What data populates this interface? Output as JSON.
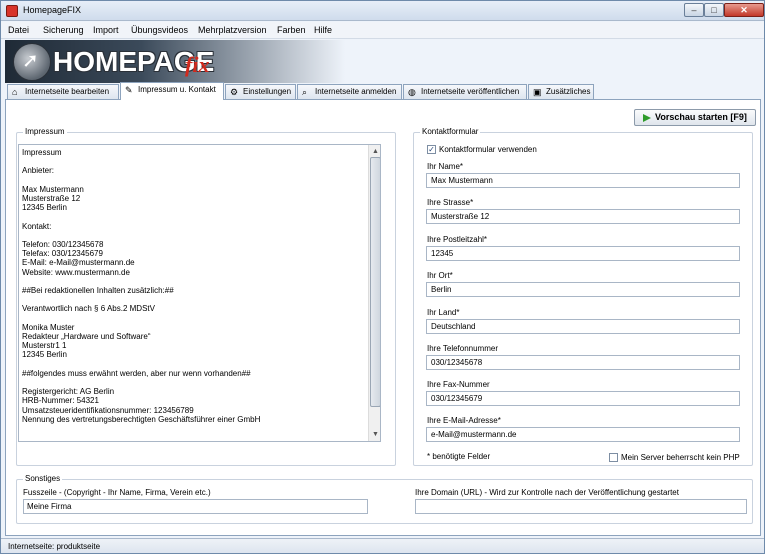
{
  "window": {
    "title": "HomepageFIX"
  },
  "menu": [
    "Datei",
    "Sicherung",
    "Import",
    "Übungsvideos",
    "Mehrplatzversion",
    "Farben",
    "Hilfe"
  ],
  "banner": {
    "logo_text": "HOMEPAGE",
    "logo_suffix": "fix"
  },
  "tabs": [
    {
      "label": "Internetseite bearbeiten",
      "icon": "house-icon"
    },
    {
      "label": "Impressum u. Kontakt",
      "icon": "notepad-icon"
    },
    {
      "label": "Einstellungen",
      "icon": "settings-icon"
    },
    {
      "label": "Internetseite anmelden",
      "icon": "search-icon"
    },
    {
      "label": "Internetseite veröffentlichen",
      "icon": "globe-icon"
    },
    {
      "label": "Zusätzliches",
      "icon": "image-icon"
    }
  ],
  "toolbar": {
    "preview_label": "Vorschau starten [F9]"
  },
  "impressum": {
    "group_label": "Impressum",
    "text_lines": [
      "Impressum",
      "",
      "Anbieter:",
      "",
      "Max Mustermann",
      "Musterstraße 12",
      "12345 Berlin",
      "",
      "Kontakt:",
      "",
      "Telefon: 030/12345678",
      "Telefax: 030/12345679",
      "E-Mail: e-Mail@mustermann.de",
      "Website: www.mustermann.de",
      "",
      "##Bei redaktionellen Inhalten zusätzlich:##",
      "",
      "Verantwortlich nach § 6 Abs.2 MDStV",
      "",
      "Monika Muster",
      "Redakteur „Hardware und Software“",
      "Musterstr1 1",
      "12345 Berlin",
      "",
      "##folgendes muss erwähnt werden, aber nur wenn vorhanden##",
      "",
      "Registergericht: AG Berlin",
      "HRB-Nummer: 54321",
      "Umsatzsteueridentifikationsnummer: 123456789",
      "Nennung des vertretungsberechtigten Geschäftsführer einer GmbH"
    ]
  },
  "kontakt": {
    "group_label": "Kontaktformular",
    "use_form_label": "Kontaktformular verwenden",
    "use_form_checked": true,
    "fields": [
      {
        "label": "Ihr Name*",
        "value": "Max Mustermann"
      },
      {
        "label": "Ihre Strasse*",
        "value": "Musterstraße 12"
      },
      {
        "label": "Ihre Postleitzahl*",
        "value": "12345"
      },
      {
        "label": "Ihr Ort*",
        "value": "Berlin"
      },
      {
        "label": "Ihr Land*",
        "value": "Deutschland"
      },
      {
        "label": "Ihre Telefonnummer",
        "value": "030/12345678"
      },
      {
        "label": "Ihre Fax-Nummer",
        "value": "030/12345679"
      },
      {
        "label": "Ihre E-Mail-Adresse*",
        "value": "e-Mail@mustermann.de"
      }
    ],
    "required_note": "* benötigte Felder",
    "no_php_label": "Mein Server beherrscht kein PHP",
    "no_php_checked": false
  },
  "sonstiges": {
    "group_label": "Sonstiges",
    "footer_label": "Fusszeile - (Copyright - Ihr Name, Firma, Verein etc.)",
    "footer_value": "Meine Firma",
    "domain_label": "Ihre Domain (URL) - Wird zur Kontrolle nach der Veröffentlichung gestartet",
    "domain_value": ""
  },
  "status": {
    "text": "Internetseite: produktseite"
  }
}
